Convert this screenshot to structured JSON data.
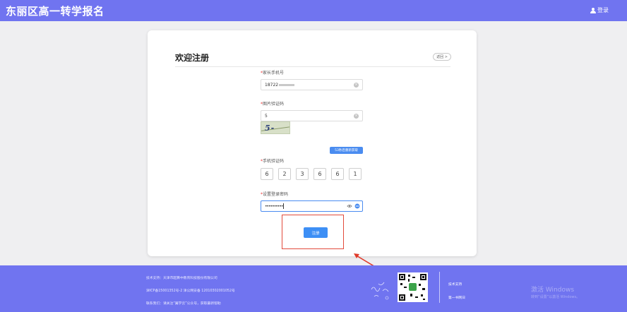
{
  "header": {
    "brand": "东丽区高一转学报名",
    "login_label": "登录"
  },
  "card": {
    "title": "欢迎注册",
    "back_label": "返回 >"
  },
  "form": {
    "phone": {
      "label": "家长手机号",
      "value_prefix": "18722"
    },
    "image_code": {
      "label": "图片验证码",
      "value": "5"
    },
    "captcha": {
      "text": "5-0=?"
    },
    "sms": {
      "label": "手机验证码",
      "countdown_label": "53秒后重新获取",
      "digits": [
        "6",
        "2",
        "3",
        "6",
        "6",
        "1"
      ]
    },
    "password": {
      "label": "设置登录密码",
      "value": "••••••••••"
    },
    "register_label": "注册"
  },
  "footer": {
    "lines": [
      "技术支持：天津市超算中教育科技股份有限公司",
      "津ICP备15001352号-2  津公网安备 12010302001052号",
      "联系我们：请关注“翼学云”公众号，获取最新帮助"
    ],
    "links": [
      "技术支持",
      "第一书网日"
    ],
    "watermark_title": "激活 Windows",
    "watermark_sub": "转到“设置”以激活 Windows。"
  },
  "colors": {
    "header_bg": "#7074f0",
    "primary_button": "#3d8ff5",
    "highlight": "#e24a3b"
  }
}
